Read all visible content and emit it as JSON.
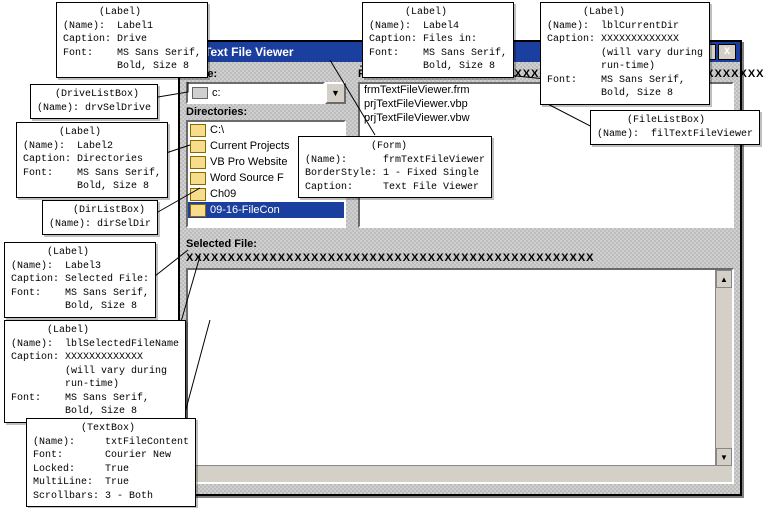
{
  "form": {
    "title": "Text File Viewer",
    "labels": {
      "drive": "Drive:",
      "directories": "Directories:",
      "filesin": "Files in:",
      "selected": "Selected File:"
    },
    "currentDir": "XXXXXXXXXXXXXXXXXXXXXXXXXXXXXXXXXXXXXXXXXXXX",
    "selectedFile": "XXXXXXXXXXXXXXXXXXXXXXXXXXXXXXXXXXXXXXXXXXXXXXXXX",
    "drive": "c:",
    "dirs": [
      "C:\\",
      "Current Projects",
      "VB Pro Website",
      "Word Source F",
      "Ch09",
      "09-16-FileCon"
    ],
    "files": [
      "frmTextFileViewer.frm",
      "prjTextFileViewer.vbp",
      "prjTextFileViewer.vbw"
    ],
    "btns": {
      "min": "_",
      "max": "□",
      "close": "X"
    },
    "dropdown": "▼"
  },
  "callouts": {
    "c1": "      (Label)\n(Name):  Label1\nCaption: Drive\nFont:    MS Sans Serif,\n         Bold, Size 8",
    "c2": "   (DriveListBox)\n(Name): drvSelDrive",
    "c3": "      (Label)\n(Name):  Label2\nCaption: Directories\nFont:    MS Sans Serif,\n         Bold, Size 8",
    "c4": "    (DirListBox)\n(Name): dirSelDir",
    "c5": "      (Label)\n(Name):  Label3\nCaption: Selected File:\nFont:    MS Sans Serif,\n         Bold, Size 8",
    "c6": "      (Label)\n(Name):  lblSelectedFileName\nCaption: XXXXXXXXXXXXX\n         (will vary during\n         run-time)\nFont:    MS Sans Serif,\n         Bold, Size 8",
    "c7": "        (TextBox)\n(Name):     txtFileContent\nFont:       Courier New\nLocked:     True\nMultiLine:  True\nScrollbars: 3 - Both",
    "c8": "           (Form)\n(Name):      frmTextFileViewer\nBorderStyle: 1 - Fixed Single\nCaption:     Text File Viewer",
    "c9": "      (Label)\n(Name):  Label4\nCaption: Files in:\nFont:    MS Sans Serif,\n         Bold, Size 8",
    "c10": "      (Label)\n(Name):  lblCurrentDir\nCaption: XXXXXXXXXXXXX\n         (will vary during\n         run-time)\nFont:    MS Sans Serif,\n         Bold, Size 8",
    "c11": "     (FileListBox)\n(Name):  filTextFileViewer"
  }
}
